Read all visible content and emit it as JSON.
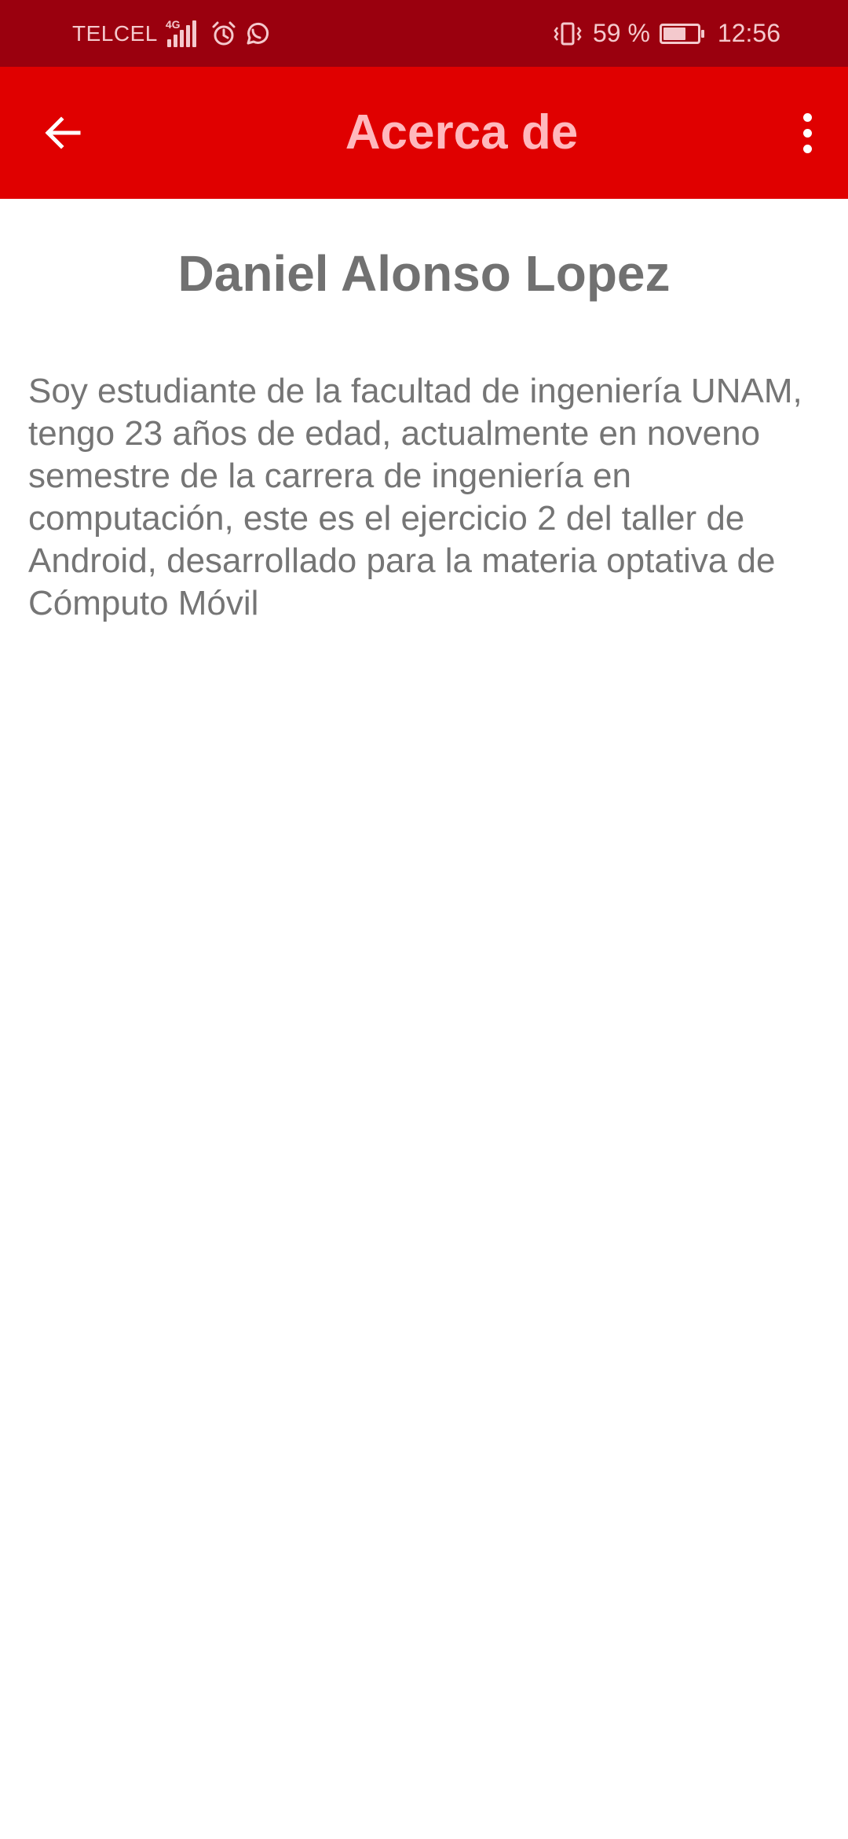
{
  "status_bar": {
    "carrier": "TELCEL",
    "network": "4G",
    "battery_text": "59 %",
    "battery_level": 0.59,
    "time": "12:56",
    "icons": [
      "signal-icon",
      "alarm-icon",
      "whatsapp-icon",
      "vibrate-icon",
      "battery-icon"
    ]
  },
  "app_bar": {
    "title": "Acerca de",
    "back_icon": "arrow-back-icon",
    "menu_icon": "more-vertical-icon"
  },
  "content": {
    "name": "Daniel Alonso Lopez",
    "description": "Soy estudiante de la facultad de ingeniería UNAM, tengo 23 años de edad, actualmente en noveno semestre de la carrera de ingeniería en computación, este es el ejercicio 2 del taller de Android, desarrollado para la materia optativa de Cómputo Móvil"
  },
  "colors": {
    "status_bar_bg": "#9a000e",
    "app_bar_bg": "#e00000",
    "title_text": "#ffb8bd",
    "body_text": "#757575"
  }
}
